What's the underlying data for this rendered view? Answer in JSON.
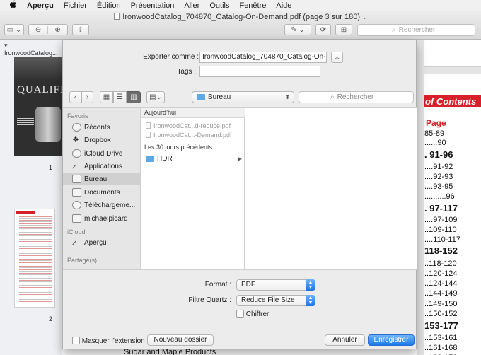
{
  "menubar": {
    "apple": "",
    "items": [
      "Aperçu",
      "Fichier",
      "Édition",
      "Présentation",
      "Aller",
      "Outils",
      "Fenêtre",
      "Aide"
    ]
  },
  "window": {
    "title": "IronwoodCatalog_704870_Catalog-On-Demand.pdf (page 3 sur 180)",
    "search_placeholder": "Rechercher"
  },
  "sidebar": {
    "title": "IronwoodCatalog...",
    "thumb1_word": "QUALIFIRS",
    "page_numbers": [
      "1",
      "2"
    ]
  },
  "document": {
    "toc_title": "of Contents",
    "page_header": "Page",
    "rows": [
      {
        "text": "85-89",
        "big": false
      },
      {
        "text": "......90",
        "big": false
      },
      {
        "text": ". 91-96",
        "big": true
      },
      {
        "text": "....91-92",
        "big": false
      },
      {
        "text": "....92-93",
        "big": false
      },
      {
        "text": "....93-95",
        "big": false
      },
      {
        "text": "..........96",
        "big": false
      },
      {
        "text": ". 97-117",
        "big": true
      },
      {
        "text": "....97-109",
        "big": false
      },
      {
        "text": "..109-110",
        "big": false
      },
      {
        "text": "....110-117",
        "big": false
      },
      {
        "text": "118-152",
        "big": true
      },
      {
        "text": "..118-120",
        "big": false
      },
      {
        "text": "..120-124",
        "big": false
      },
      {
        "text": "..124-144",
        "big": false
      },
      {
        "text": "..144-149",
        "big": false
      },
      {
        "text": "..149-150",
        "big": false
      },
      {
        "text": "..150-152",
        "big": false
      },
      {
        "text": "153-177",
        "big": true
      },
      {
        "text": "..153-161",
        "big": false
      },
      {
        "text": "..161-168",
        "big": false
      },
      {
        "text": "..168-173",
        "big": false
      }
    ],
    "bottom_text": "Sugar and Maple Products"
  },
  "dialog": {
    "export_label": "Exporter comme :",
    "export_value": "IronwoodCatalog_704870_Catalog-On-",
    "tags_label": "Tags :",
    "tags_value": "",
    "location": "Bureau",
    "search_placeholder": "Rechercher",
    "favorites_header": "Favoris",
    "favorites": [
      {
        "icon": "clock-icon",
        "label": "Récents",
        "selected": false
      },
      {
        "icon": "dropbox-icon",
        "label": "Dropbox",
        "selected": false
      },
      {
        "icon": "cloud-icon",
        "label": "iCloud Drive",
        "selected": false
      },
      {
        "icon": "applications-icon",
        "label": "Applications",
        "selected": false
      },
      {
        "icon": "desktop-icon",
        "label": "Bureau",
        "selected": true
      },
      {
        "icon": "documents-icon",
        "label": "Documents",
        "selected": false
      },
      {
        "icon": "downloads-icon",
        "label": "Téléchargeme...",
        "selected": false
      },
      {
        "icon": "home-icon",
        "label": "michaelpicard",
        "selected": false
      }
    ],
    "icloud_header": "iCloud",
    "icloud_items": [
      {
        "icon": "preview-icon",
        "label": "Aperçu"
      }
    ],
    "shared_header": "Partagé(s)",
    "column_header": "Aujourd’hui",
    "today_files": [
      "IronwoodCat...d-reduce.pdf",
      "IronwoodCat...-Demand.pdf"
    ],
    "recent_header": "Les 30 jours précédents",
    "recent_folder": "HDR",
    "format_label": "Format :",
    "format_value": "PDF",
    "quartz_label": "Filtre Quartz :",
    "quartz_value": "Reduce File Size",
    "encrypt_label": "Chiffrer",
    "hide_ext_label": "Masquer l’extension",
    "new_folder_label": "Nouveau dossier",
    "cancel_label": "Annuler",
    "save_label": "Enregistrer",
    "accent_color": "#1b79ea"
  }
}
